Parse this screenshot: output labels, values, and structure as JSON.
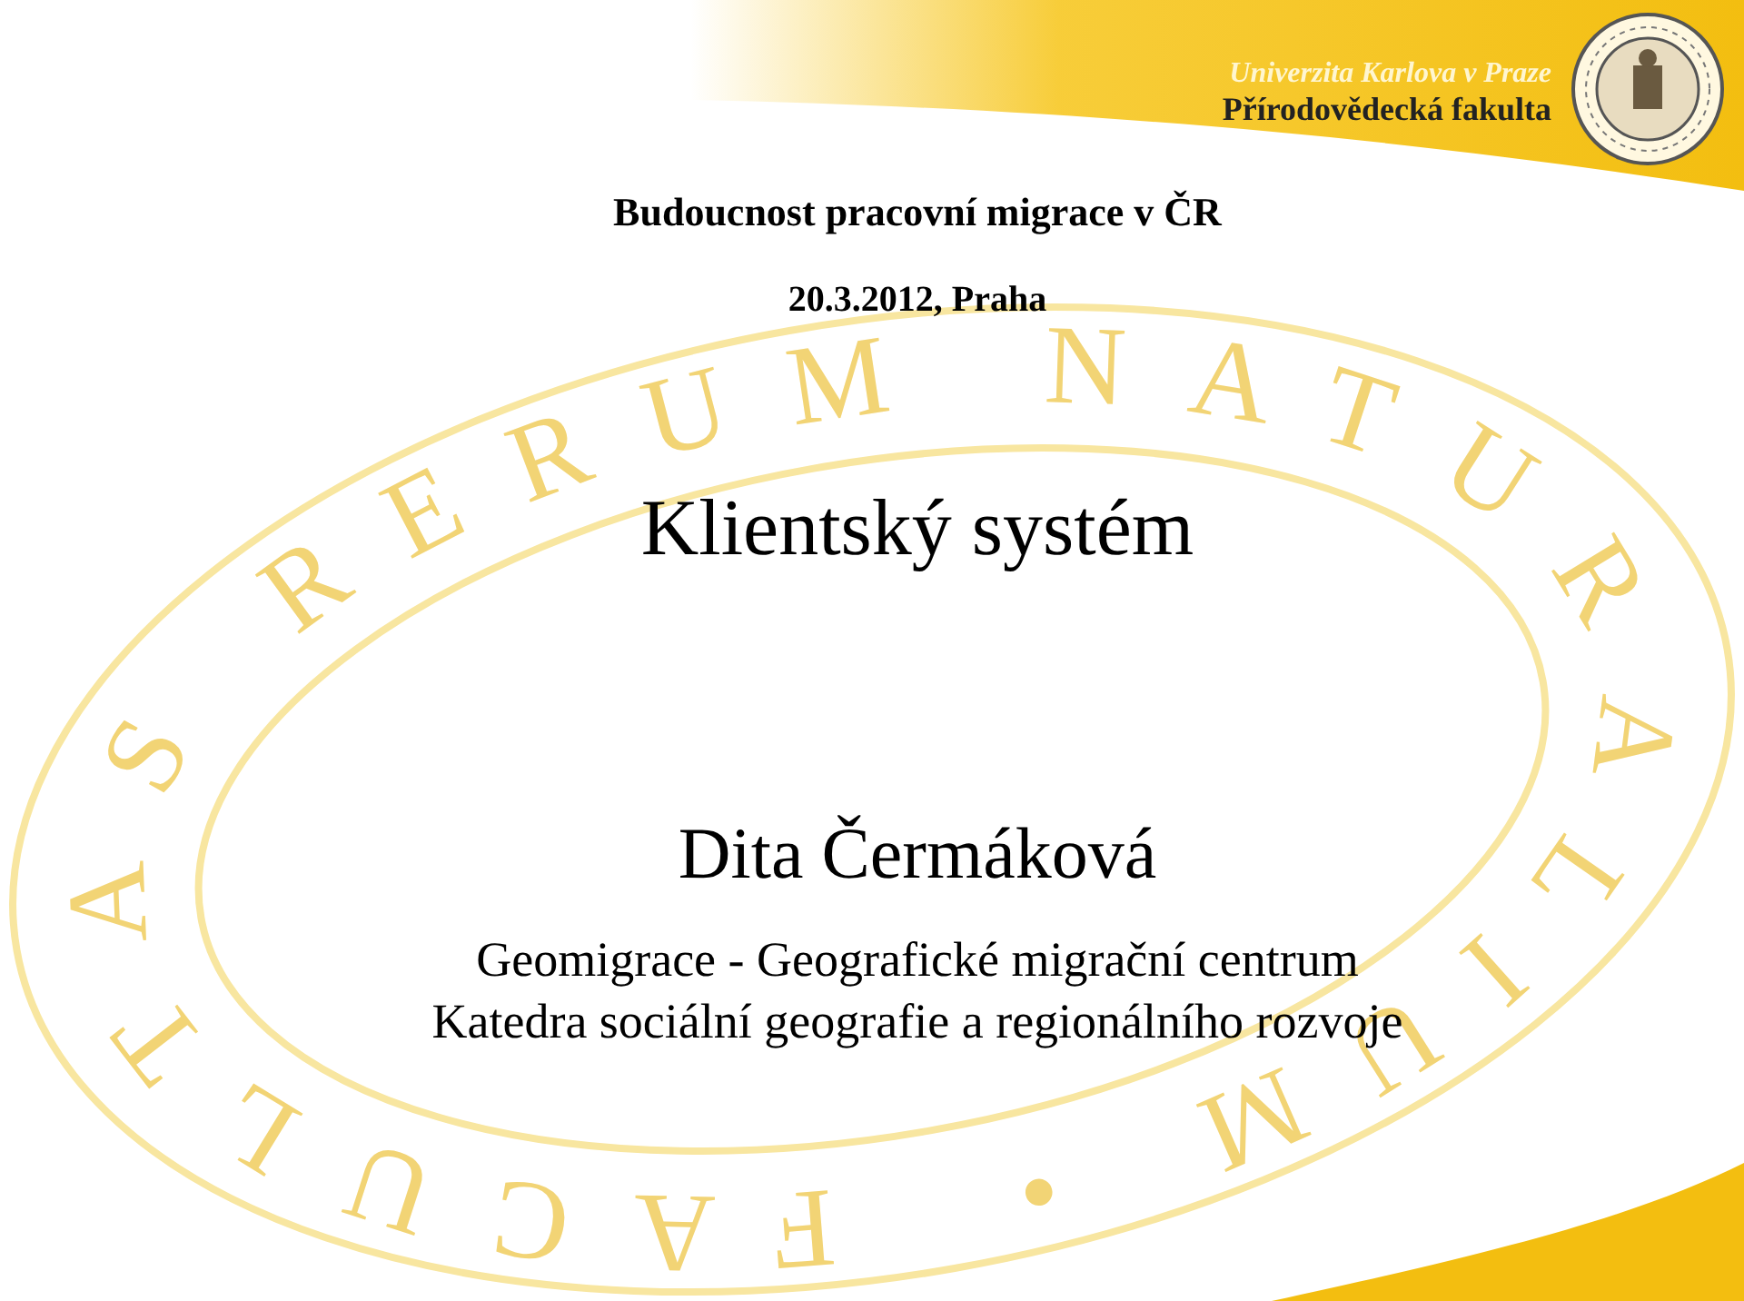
{
  "header": {
    "university": "Univerzita Karlova v Praze",
    "faculty": "Přírodovědecká fakulta"
  },
  "background_seal": {
    "text": "FACULTAS RERUM NATURALIUM •"
  },
  "event": {
    "title": "Budoucnost pracovní migrace v ČR",
    "date_place": "20.3.2012, Praha"
  },
  "slide_title": "Klientský systém",
  "author": {
    "name": "Dita Čermáková",
    "affiliations": [
      "Geomigrace - Geografické migrační centrum",
      "Katedra sociální geografie a regionálního rozvoje"
    ]
  }
}
